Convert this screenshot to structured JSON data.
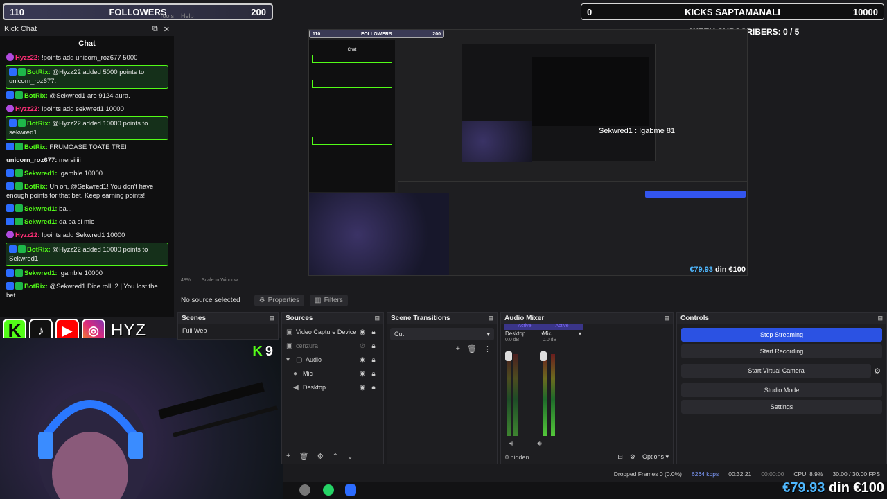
{
  "overlays": {
    "followers_left": "110",
    "followers_title": "FOLLOWERS",
    "followers_goal": "200",
    "kicks_left": "0",
    "kicks_title": "KICKS SAPTAMANALI",
    "kicks_goal": "10000",
    "week_subs": "WEEK SUBSCRIBERS: 0 / 5"
  },
  "menu": {
    "tools": "Tools",
    "help": "Help"
  },
  "chat_panel": {
    "dock_title": "Kick Chat",
    "tab": "Chat",
    "messages": [
      {
        "user": "Hyzz22:",
        "text": " !points add unicorn_roz677 5000",
        "color": "pink",
        "hl": false
      },
      {
        "user": "BotRix:",
        "text": " @Hyzz22 added 5000 points to unicorn_roz677.",
        "color": "green",
        "hl": true
      },
      {
        "user": "BotRix:",
        "text": " @Sekwred1 are 9124 aura.",
        "color": "green",
        "hl": false
      },
      {
        "user": "Hyzz22:",
        "text": " !points add sekwred1 10000",
        "color": "pink",
        "hl": false
      },
      {
        "user": "BotRix:",
        "text": " @Hyzz22 added 10000 points to sekwred1.",
        "color": "green",
        "hl": true
      },
      {
        "user": "BotRix:",
        "text": " FRUMOASE TOATE TREI",
        "color": "green",
        "hl": false
      },
      {
        "user": "unicorn_roz677:",
        "text": " mersiiiii",
        "color": "white",
        "hl": false
      },
      {
        "user": "Sekwred1:",
        "text": " !gamble 10000",
        "color": "green",
        "hl": false
      },
      {
        "user": "BotRix:",
        "text": " Uh oh, @Sekwred1! You don't have enough points for that bet. Keep earning points!",
        "color": "green",
        "hl": false
      },
      {
        "user": "Sekwred1:",
        "text": " ba...",
        "color": "green",
        "hl": false
      },
      {
        "user": "Sekwred1:",
        "text": " da ba si mie",
        "color": "green",
        "hl": false
      },
      {
        "user": "Hyzz22:",
        "text": " !points add Sekwred1 10000",
        "color": "pink",
        "hl": false
      },
      {
        "user": "BotRix:",
        "text": " @Hyzz22 added 10000 points to Sekwred1.",
        "color": "green",
        "hl": true
      },
      {
        "user": "Sekwred1:",
        "text": " !gamble 10000",
        "color": "green",
        "hl": false
      },
      {
        "user": "BotRix:",
        "text": " @Sekwred1 Dice roll: 2 | You lost the bet",
        "color": "green",
        "hl": false
      }
    ]
  },
  "socials": {
    "kick": "K",
    "tiktok": "♪",
    "youtube": "▶",
    "instagram": "◎",
    "brand": "HYZ"
  },
  "webcam": {
    "kick_label": "K",
    "kick_count": "9"
  },
  "preview": {
    "follow_left": "110",
    "follow_title": "FOLLOWERS",
    "follow_goal": "200",
    "chat_tab": "Chat",
    "sekwred": "Sekwred1 : !gabme 81",
    "euro_amount": "€79.93",
    "euro_goal": " din €100"
  },
  "obs": {
    "zoom": "48%",
    "scale": "Scale to Window",
    "no_source": "No source selected",
    "properties": "Properties",
    "filters": "Filters",
    "scenes": {
      "title": "Scenes",
      "items": [
        "Full Web"
      ]
    },
    "sources": {
      "title": "Sources",
      "items": [
        {
          "name": "Video Capture Device",
          "icon": "▣"
        },
        {
          "name": "cenzura",
          "icon": "▣"
        },
        {
          "name": "Audio",
          "icon": "▢"
        },
        {
          "name": "Mic",
          "icon": "🎙"
        },
        {
          "name": "Desktop",
          "icon": "🔊"
        }
      ]
    },
    "transitions": {
      "title": "Scene Transitions",
      "value": "Cut"
    },
    "mixer": {
      "title": "Audio Mixer",
      "active": "Active",
      "ch1": "Desktop",
      "ch2": "Mic",
      "db1": "0.0 dB",
      "db2": "0.0 dB",
      "hidden": "0 hidden",
      "options": "Options"
    },
    "controls": {
      "title": "Controls",
      "stop_streaming": "Stop Streaming",
      "start_recording": "Start Recording",
      "start_virtual_camera": "Start Virtual Camera",
      "studio_mode": "Studio Mode",
      "settings": "Settings"
    },
    "status": {
      "dropped": "Dropped Frames 0 (0.0%)",
      "kbps": "6264 kbps",
      "live_time": "00:32:21",
      "rec_time": "00:00:00",
      "cpu": "CPU: 8.9%",
      "fps": "30.00 / 30.00 FPS"
    }
  },
  "euro_overlay": {
    "amount": "€79.93",
    "goal": " din €100"
  },
  "colors": {
    "kick_green": "#53fc18",
    "obs_blue": "#2b52e3",
    "pink_user": "#ff2f77"
  }
}
